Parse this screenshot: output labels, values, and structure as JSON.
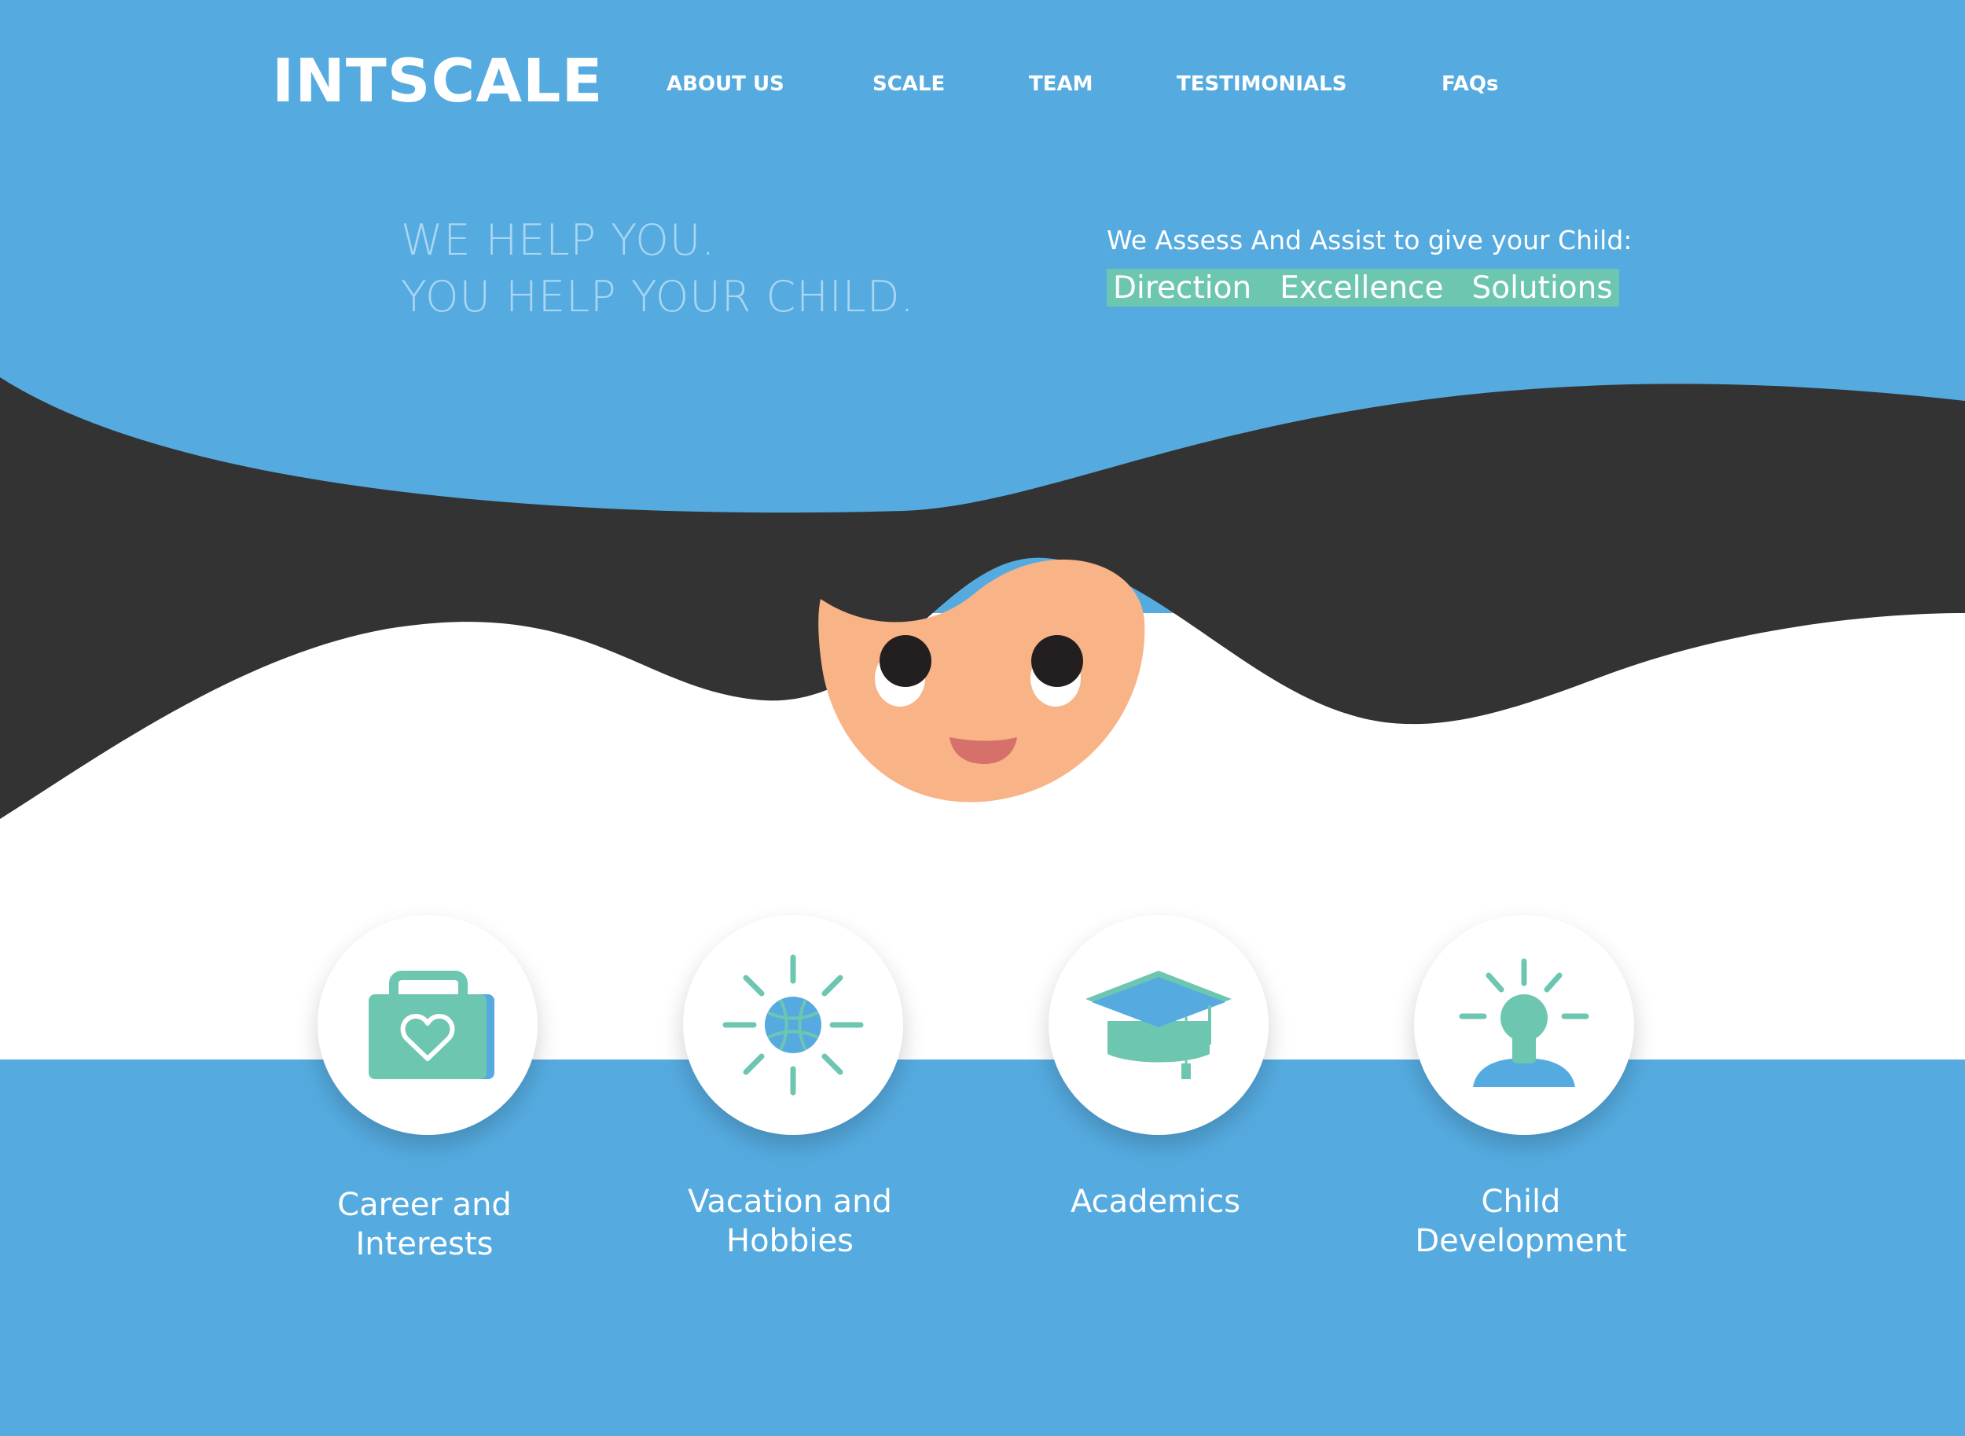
{
  "brand": {
    "logo": "INTSCALE"
  },
  "nav": {
    "items": [
      "ABOUT US",
      "SCALE",
      "TEAM",
      "TESTIMONIALS",
      "FAQs"
    ]
  },
  "hero": {
    "tagline_line1": "WE HELP YOU.",
    "tagline_line2": "YOU HELP YOUR CHILD.",
    "assist_text": "We Assess And Assist to give your Child:",
    "pills": [
      "Direction",
      "Excellence",
      "Solutions"
    ]
  },
  "features": [
    {
      "label_line1": "Career and",
      "label_line2": "Interests",
      "icon": "briefcase-heart-icon"
    },
    {
      "label_line1": "Vacation and",
      "label_line2": "Hobbies",
      "icon": "sun-ball-icon"
    },
    {
      "label_line1": "Academics",
      "label_line2": "",
      "icon": "graduation-cap-icon"
    },
    {
      "label_line1": "Child",
      "label_line2": "Development",
      "icon": "idea-person-icon"
    }
  ],
  "colors": {
    "primary_blue": "#55abe0",
    "hair": "#333333",
    "accent_green": "#6dc6b0",
    "face": "#f8b386",
    "mouth": "#d6706a",
    "white": "#ffffff"
  }
}
